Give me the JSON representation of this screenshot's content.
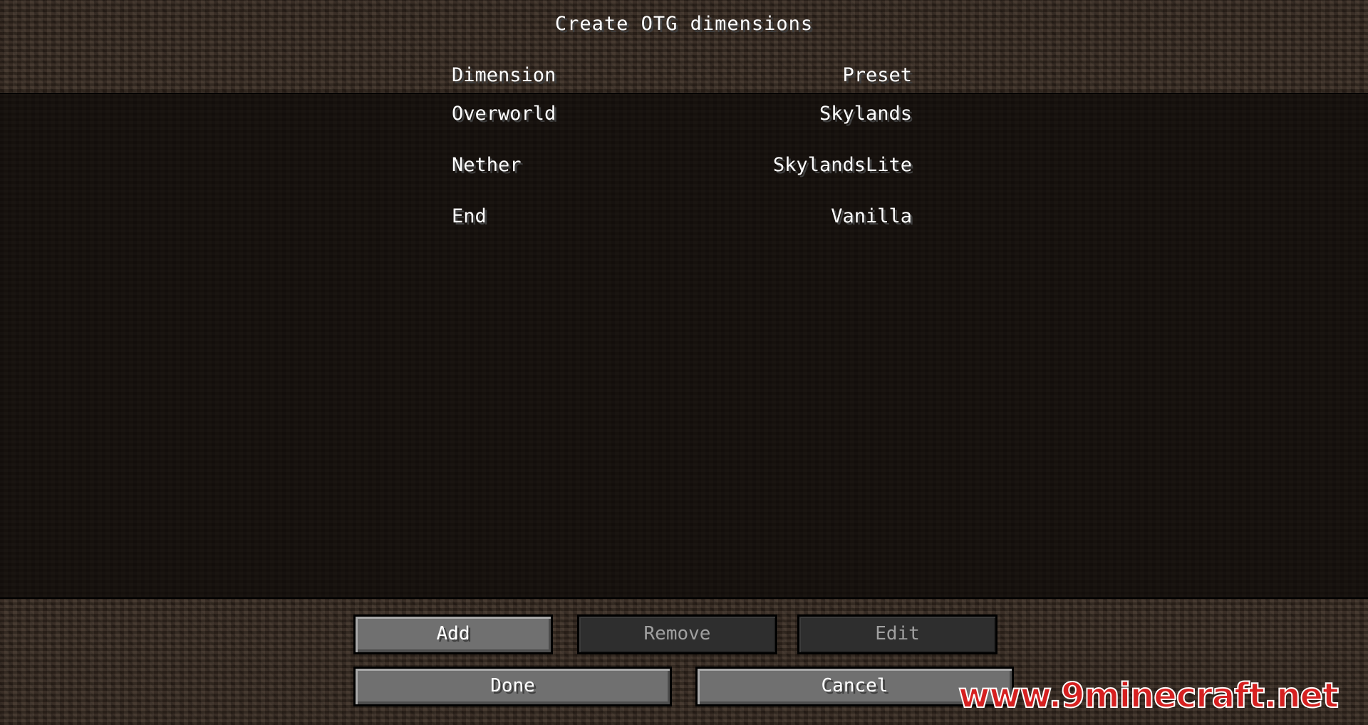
{
  "screen": {
    "title": "Create OTG dimensions"
  },
  "list": {
    "columns": {
      "dimension": "Dimension",
      "preset": "Preset"
    },
    "rows": [
      {
        "dimension": "Overworld",
        "preset": "Skylands"
      },
      {
        "dimension": "Nether",
        "preset": "SkylandsLite"
      },
      {
        "dimension": "End",
        "preset": "Vanilla"
      }
    ]
  },
  "buttons": {
    "add": "Add",
    "remove": "Remove",
    "edit": "Edit",
    "done": "Done",
    "cancel": "Cancel"
  },
  "watermark": {
    "text": "www.9minecraft.net",
    "color": "#d62020"
  }
}
